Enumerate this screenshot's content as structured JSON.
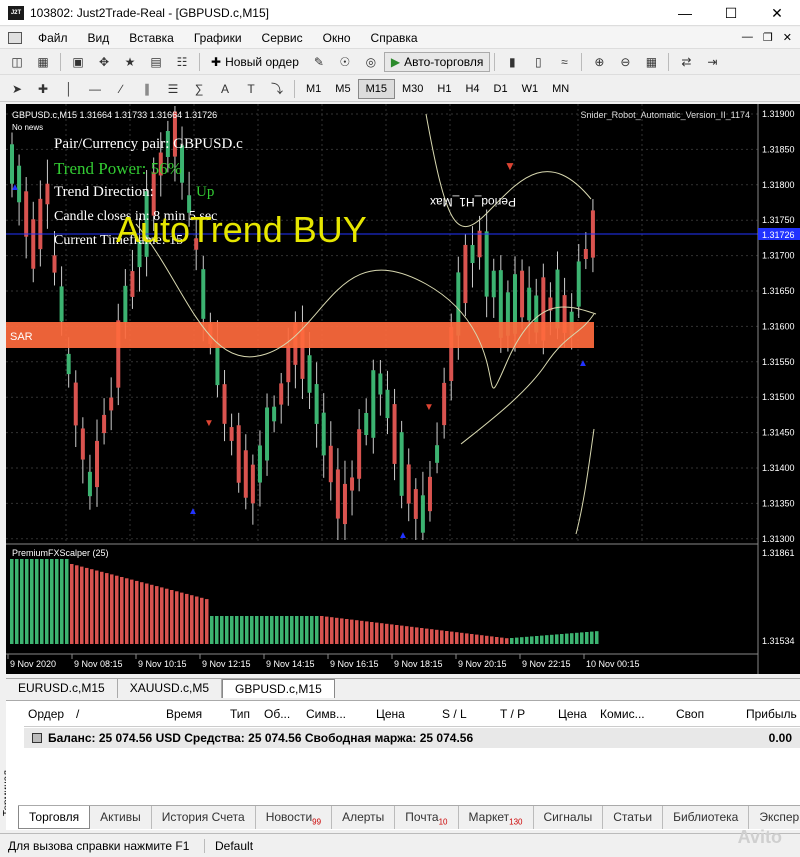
{
  "window": {
    "title": "103802: Just2Trade-Real - [GBPUSD.c,M15]",
    "app_icon_text": "J2T"
  },
  "menu": [
    "Файл",
    "Вид",
    "Вставка",
    "Графики",
    "Сервис",
    "Окно",
    "Справка"
  ],
  "toolbar": {
    "new_order": "Новый ордер",
    "auto_trading": "Авто-торговля"
  },
  "timeframes": [
    "M1",
    "M5",
    "M15",
    "M30",
    "H1",
    "H4",
    "D1",
    "W1",
    "MN"
  ],
  "active_timeframe": "M15",
  "chart": {
    "header": "GBPUSD.c,M15  1.31664 1.31733 1.31664 1.31726",
    "no_news": "No news",
    "robot_label": "Snider_Robot_Automatic_Version_II_1174",
    "pair_line": "Pair/Currency pair: GBPUSD.c",
    "trend_power": "Trend Power: 56%",
    "trend_direction_label": "Trend Direction:",
    "trend_direction_value": "Up",
    "candle_closes": "Candle closes in: 8 min 5 sec",
    "current_timeframe": "Current Timeframe: 15",
    "big_signal": "AutoTrend BUY",
    "period_label": "Period_H1_Max",
    "sar_label": "SAR",
    "indicator_label": "PremiumFXScalper (25)",
    "price_labels": [
      "1.31900",
      "1.31850",
      "1.31800",
      "1.31750",
      "1.31700",
      "1.31650",
      "1.31600",
      "1.31550",
      "1.31500",
      "1.31450",
      "1.31400",
      "1.31350",
      "1.31300"
    ],
    "current_price": "1.31726",
    "indicator_scale_top": "1.31861",
    "indicator_scale_bottom": "1.31534",
    "time_labels": [
      "9 Nov 2020",
      "9 Nov 08:15",
      "9 Nov 10:15",
      "9 Nov 12:15",
      "9 Nov 14:15",
      "9 Nov 16:15",
      "9 Nov 18:15",
      "9 Nov 20:15",
      "9 Nov 22:15",
      "10 Nov 00:15"
    ],
    "colors": {
      "bull": "#3cb371",
      "bear": "#d9534f",
      "sar_band": "#ff6a3d",
      "signal_text": "#e6e600",
      "trend_power": "#33cc33",
      "current_price_line": "#2233ff"
    }
  },
  "chart_tabs": [
    "EURUSD.c,M15",
    "XAUUSD.c,M5",
    "GBPUSD.c,M15"
  ],
  "active_chart_tab": "GBPUSD.c,M15",
  "terminal": {
    "side_label": "Терминал",
    "columns": [
      "Ордер",
      "/",
      "Время",
      "Тип",
      "Об...",
      "Симв...",
      "Цена",
      "S / L",
      "T / P",
      "Цена",
      "Комис...",
      "Своп",
      "Прибыль"
    ],
    "balance_line": "Баланс: 25 074.56 USD  Средства: 25 074.56  Свободная маржа: 25 074.56",
    "profit_total": "0.00"
  },
  "bottom_tabs": [
    {
      "label": "Торговля",
      "badge": ""
    },
    {
      "label": "Активы",
      "badge": ""
    },
    {
      "label": "История Счета",
      "badge": ""
    },
    {
      "label": "Новости",
      "badge": "99"
    },
    {
      "label": "Алерты",
      "badge": ""
    },
    {
      "label": "Почта",
      "badge": "10"
    },
    {
      "label": "Маркет",
      "badge": "130"
    },
    {
      "label": "Сигналы",
      "badge": ""
    },
    {
      "label": "Статьи",
      "badge": ""
    },
    {
      "label": "Библиотека",
      "badge": ""
    },
    {
      "label": "Экспер",
      "badge": ""
    }
  ],
  "status": {
    "help": "Для вызова справки нажмите F1",
    "profile": "Default"
  },
  "watermark": "Avito"
}
